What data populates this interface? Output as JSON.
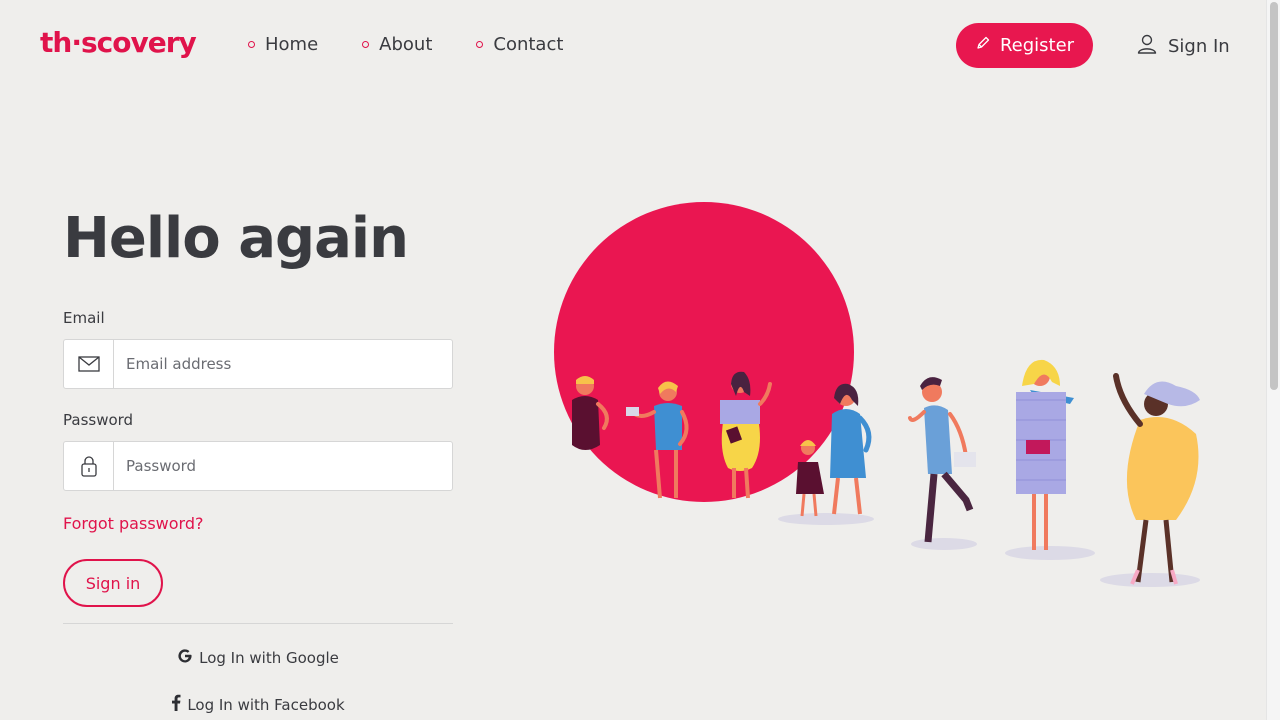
{
  "header": {
    "logo_text": "th·scovery",
    "nav": [
      {
        "label": "Home"
      },
      {
        "label": "About"
      },
      {
        "label": "Contact"
      }
    ],
    "register_label": "Register",
    "signin_label": "Sign In"
  },
  "form": {
    "title": "Hello again",
    "email_label": "Email",
    "email_placeholder": "Email address",
    "password_label": "Password",
    "password_placeholder": "Password",
    "forgot_label": "Forgot password?",
    "signin_button": "Sign in",
    "google_label": "Log In with Google",
    "facebook_label": "Log In with Facebook"
  },
  "colors": {
    "accent": "#e0134b",
    "background": "#efeeec",
    "text": "#3a3b40"
  },
  "icons": [
    "pencil-icon",
    "user-icon",
    "mail-icon",
    "lock-icon",
    "google-icon",
    "facebook-icon"
  ]
}
